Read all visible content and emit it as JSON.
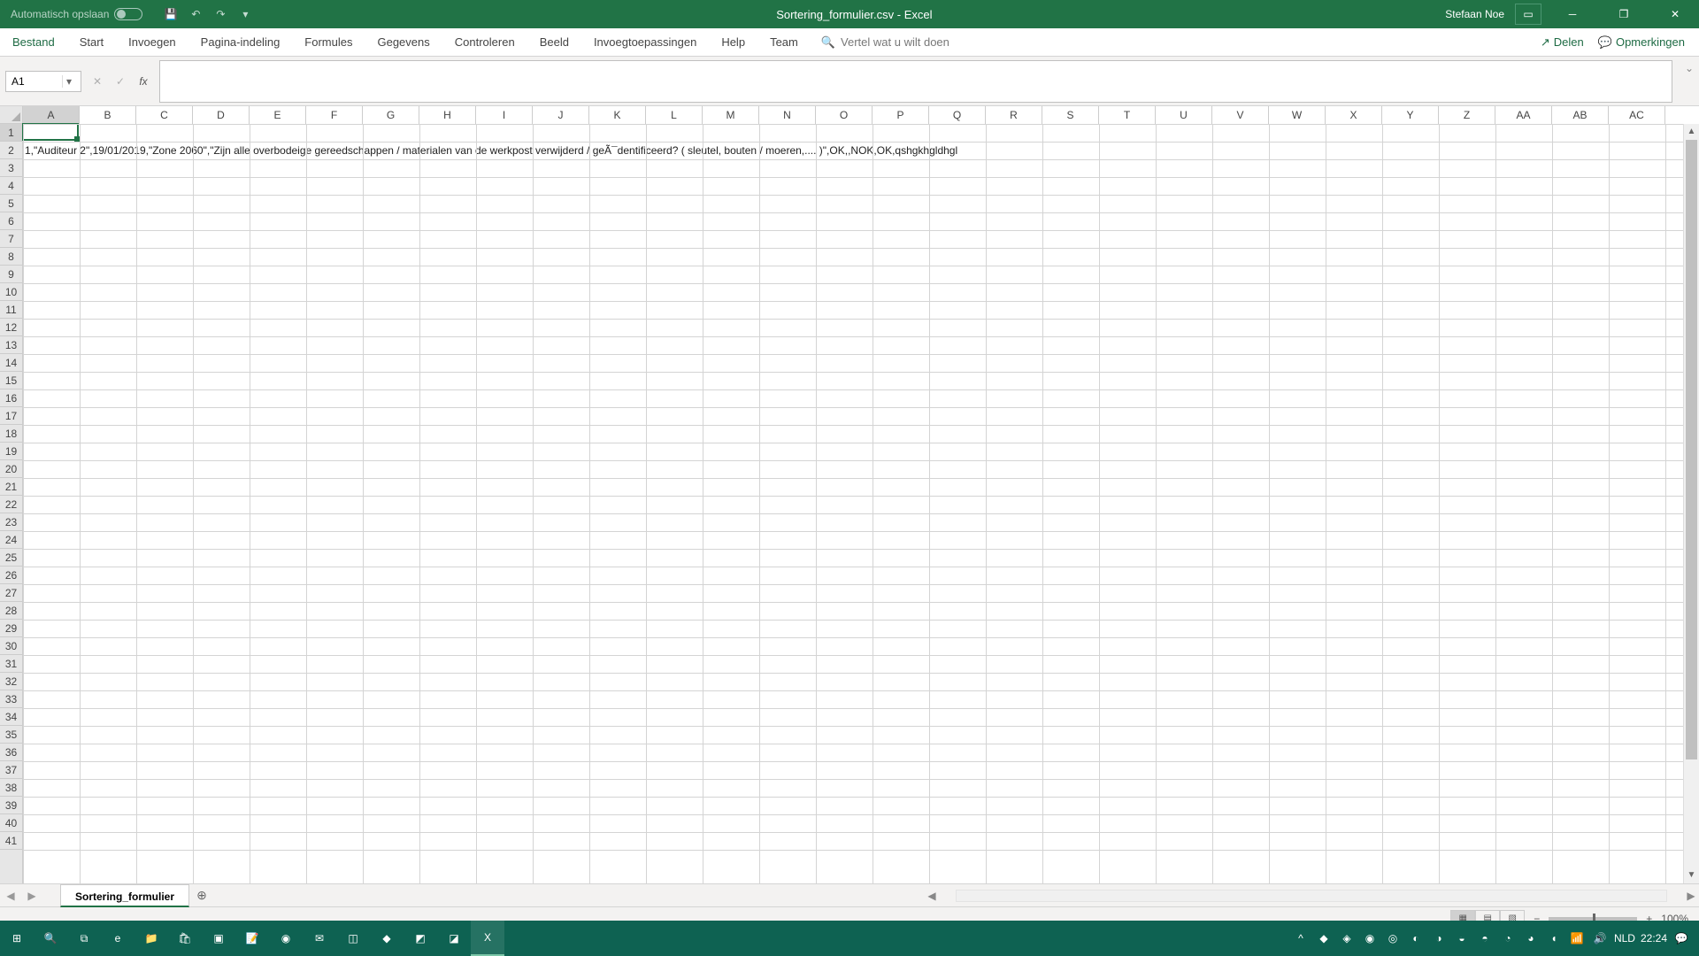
{
  "title_bar": {
    "autosave_label": "Automatisch opslaan",
    "document_title": "Sortering_formulier.csv  -  Excel",
    "user_name": "Stefaan Noe"
  },
  "ribbon_tabs": [
    "Bestand",
    "Start",
    "Invoegen",
    "Pagina-indeling",
    "Formules",
    "Gegevens",
    "Controleren",
    "Beeld",
    "Invoegtoepassingen",
    "Help",
    "Team"
  ],
  "tell_me_placeholder": "Vertel wat u wilt doen",
  "share_label": "Delen",
  "comments_label": "Opmerkingen",
  "name_box": "A1",
  "columns": [
    "A",
    "B",
    "C",
    "D",
    "E",
    "F",
    "G",
    "H",
    "I",
    "J",
    "K",
    "L",
    "M",
    "N",
    "O",
    "P",
    "Q",
    "R",
    "S",
    "T",
    "U",
    "V",
    "W",
    "X",
    "Y",
    "Z",
    "AA",
    "AB",
    "AC"
  ],
  "row_count": 41,
  "active_cell_ref": "A1",
  "row2_text": "1,\"Auditeur 2\",19/01/2019,\"Zone 2060\",\"Zijn alle overbodeige gereedschappen / materialen van de werkpost verwijderd / geÃ¯dentificeerd? ( sleutel, bouten / moeren,.... )\",OK,,NOK,OK,qshgkhgldhgl",
  "sheet_tab": "Sortering_formulier",
  "zoom": "100%",
  "clock": "22:24",
  "lang": "NLD",
  "status_zoom_plus": "+",
  "status_zoom_minus": "−"
}
